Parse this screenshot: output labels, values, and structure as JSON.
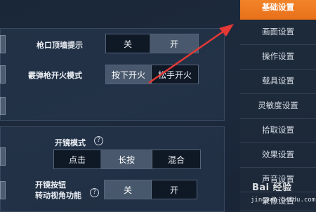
{
  "settings": {
    "muzzle_hint": {
      "label": "枪口顶墙提示",
      "options": [
        "关",
        "开"
      ],
      "selected": "开"
    },
    "shotgun_fire": {
      "label": "霰弹枪开火模式",
      "options": [
        "按下开火",
        "松手开火"
      ],
      "selected": "按下开火"
    },
    "scope_mode": {
      "label": "开镜模式",
      "help": "?",
      "options": [
        "点击",
        "长按",
        "混合"
      ],
      "selected": "长按"
    },
    "scope_turn": {
      "label_line1": "开镜按钮",
      "label_line2": "转动视角功能",
      "help": "?",
      "options": [
        "关",
        "开"
      ],
      "selected": "关"
    }
  },
  "sidebar": {
    "items": [
      {
        "label": "基础设置",
        "active": true
      },
      {
        "label": "画面设置",
        "active": false
      },
      {
        "label": "操作设置",
        "active": false
      },
      {
        "label": "载具设置",
        "active": false
      },
      {
        "label": "灵敏度设置",
        "active": false
      },
      {
        "label": "拾取设置",
        "active": false
      },
      {
        "label": "效果设置",
        "active": false
      },
      {
        "label": "声音设置",
        "active": false
      },
      {
        "label": "录像设置",
        "active": false
      }
    ]
  },
  "watermark": {
    "brand": "Bai 经验",
    "url": "jingyan.baidu.com"
  },
  "colors": {
    "accent": "#f07a22",
    "annotation_arrow": "#e53935"
  }
}
